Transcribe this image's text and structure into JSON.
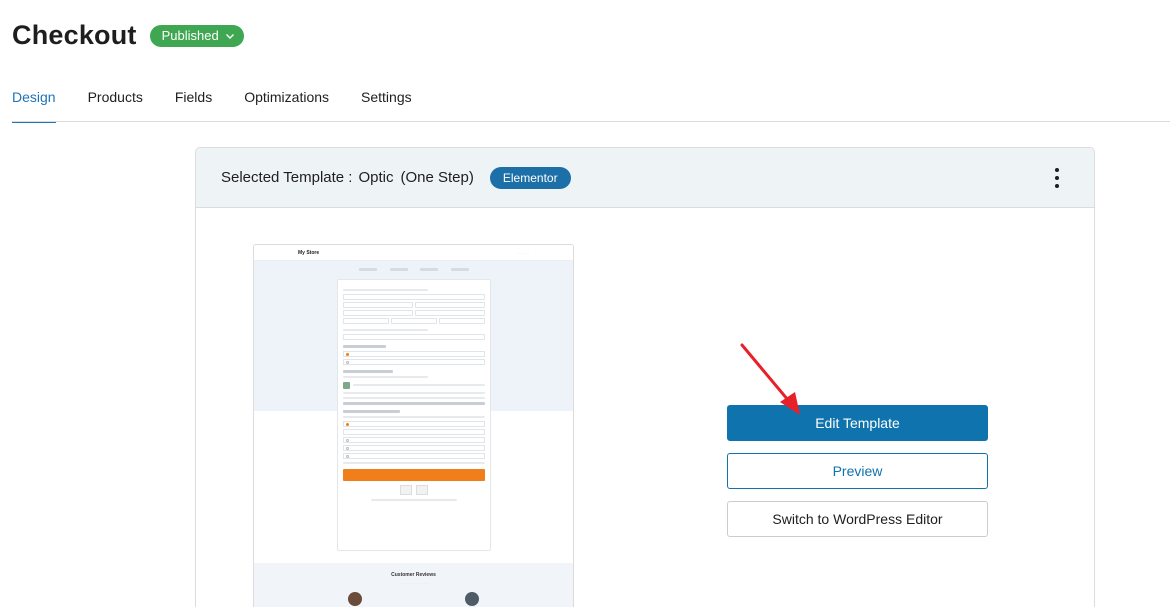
{
  "header": {
    "title": "Checkout",
    "status": "Published"
  },
  "tabs": [
    {
      "label": "Design",
      "active": true
    },
    {
      "label": "Products",
      "active": false
    },
    {
      "label": "Fields",
      "active": false
    },
    {
      "label": "Optimizations",
      "active": false
    },
    {
      "label": "Settings",
      "active": false
    }
  ],
  "template": {
    "label": "Selected Template :",
    "name": "Optic",
    "variant": "(One Step)",
    "builder": "Elementor"
  },
  "actions": {
    "edit": "Edit Template",
    "preview": "Preview",
    "switch": "Switch to WordPress Editor"
  },
  "thumbnail": {
    "store_name": "My Store",
    "reviews_title": "Customer Reviews"
  },
  "colors": {
    "status_green": "#3fa652",
    "primary_blue": "#0f73ad",
    "badge_blue": "#1d6fa8",
    "arrow_red": "#e8202a",
    "panel_header": "#eef3f6"
  },
  "icons": {
    "status_dropdown": "chevron-down-icon",
    "more_menu": "more-vertical-icon",
    "annotation": "red-arrow-icon"
  }
}
